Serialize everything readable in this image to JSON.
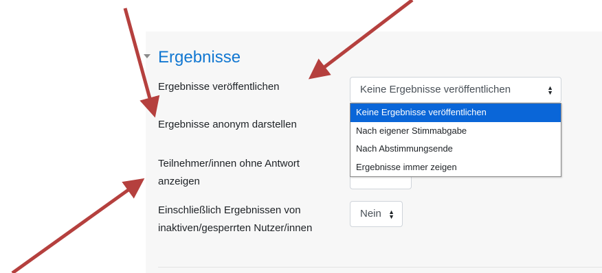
{
  "section": {
    "title": "Ergebnisse",
    "toggle_icon": "triangle-down-icon"
  },
  "fields": [
    {
      "label": "Ergebnisse veröffentlichen",
      "value": "Keine Ergebnisse veröffentlichen",
      "expanded": true,
      "options": [
        "Keine Ergebnisse veröffentlichen",
        "Nach eigener Stimmabgabe",
        "Nach Abstimmungsende",
        "Ergebnisse immer zeigen"
      ],
      "selected_index": 0
    },
    {
      "label": "Ergebnisse anonym darstellen"
    },
    {
      "label": "Teilnehmer/innen ohne Antwort anzeigen"
    },
    {
      "label": "Einschließlich Ergebnissen von inaktiven/gesperrten Nutzer/innen",
      "value": "Nein"
    }
  ],
  "caret_icon": "up-down-caret-icon",
  "colors": {
    "accent": "#1177d1",
    "selection": "#0a66d8",
    "annotation_arrow": "#b5403e"
  }
}
